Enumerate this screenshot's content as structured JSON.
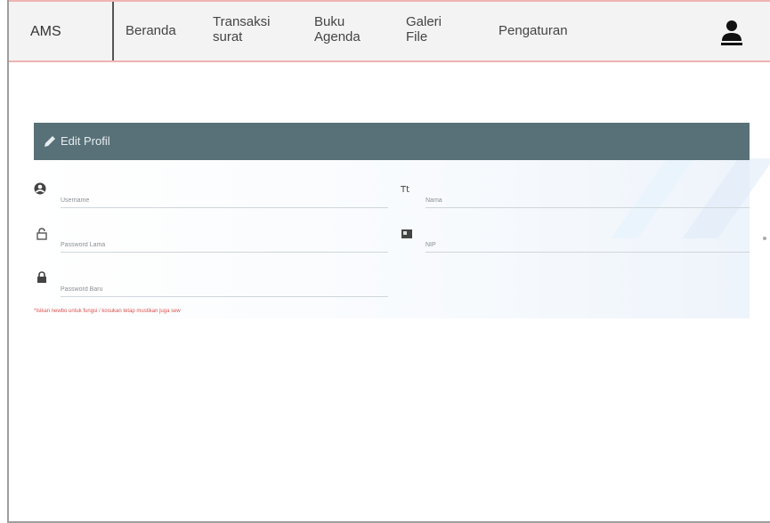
{
  "navbar": {
    "brand": "AMS",
    "items": [
      {
        "label": "Beranda"
      },
      {
        "label": "Transaksi surat"
      },
      {
        "label": "Buku Agenda"
      },
      {
        "label": "Galeri File"
      },
      {
        "label": "Pengaturan"
      }
    ],
    "user_icon": "user-icon"
  },
  "card": {
    "title": "Edit Profil",
    "title_icon": "pencil-icon",
    "header_color": "#587078",
    "fields": [
      {
        "placeholder": "Username",
        "icon": "user-circle-icon"
      },
      {
        "placeholder": "Nama",
        "icon": "text-icon"
      },
      {
        "placeholder": "Password Lama",
        "icon": "unlock-icon"
      },
      {
        "placeholder": "NIP",
        "icon": "id-card-icon"
      },
      {
        "placeholder": "Password Baru",
        "icon": "lock-icon"
      }
    ],
    "note": "*Isikan newbo untuk fungsi / kosukan tetap mustikan juga sew"
  },
  "colors": {
    "nav_border": "#f0b3b3",
    "note": "#d9534f"
  }
}
